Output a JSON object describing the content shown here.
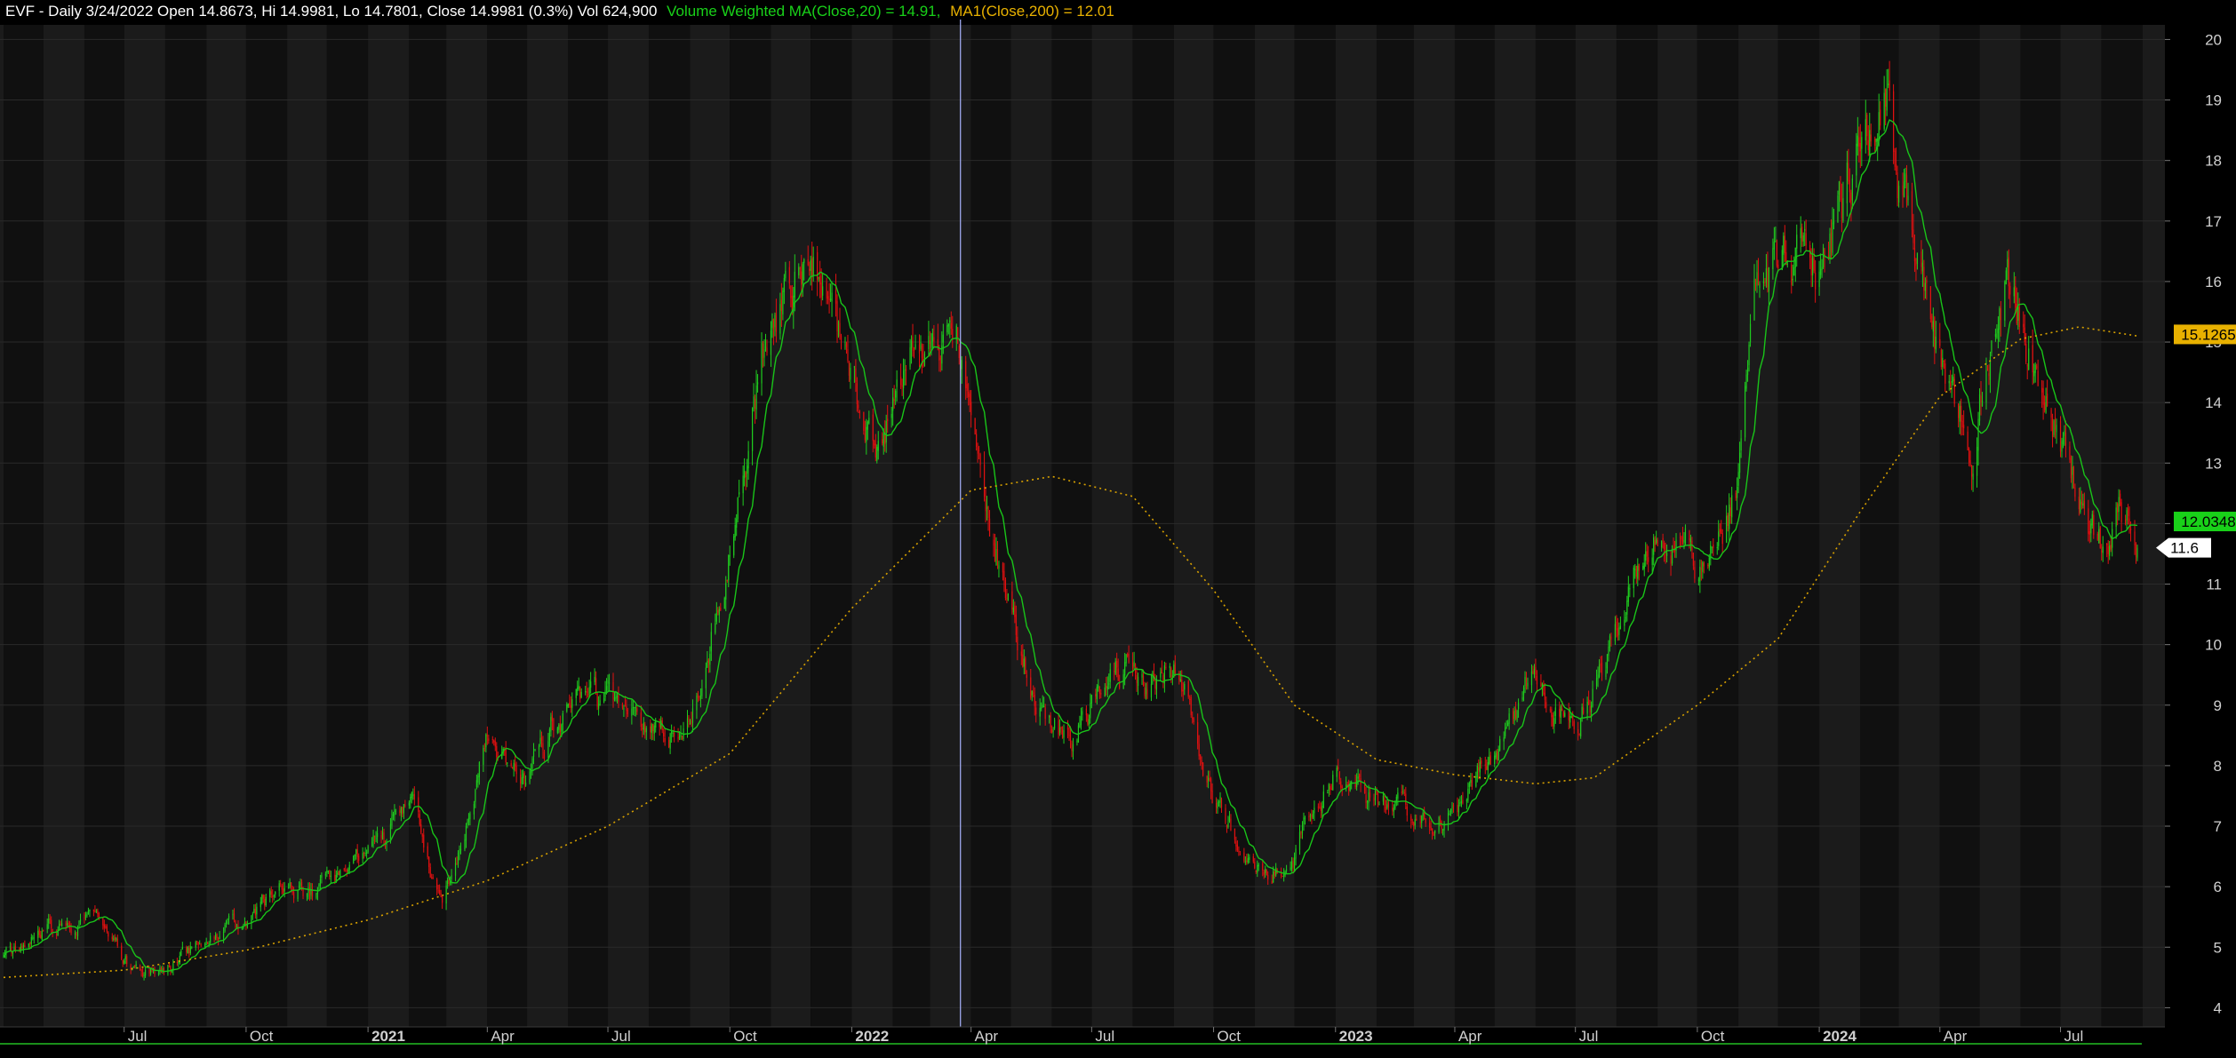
{
  "header": {
    "prefix": "EVF - Daily 3/24/2022 Open 14.8673, Hi 14.9981, Lo 14.7801, Close 14.9981 (0.3%) Vol 624,900",
    "vwma_label": "Volume Weighted MA(Close,20) = 14.91,",
    "ma_label": "MA1(Close,200) = 12.01",
    "colors": {
      "prefix": "#ffffff",
      "vwma": "#19d119",
      "ma": "#e8b100"
    }
  },
  "colors": {
    "background": "#000000",
    "band_light": "#1b1b1b",
    "band_dark": "#101010",
    "grid": "#2a2a2a",
    "up": "#1fcc1f",
    "down": "#e01010",
    "vwma": "#19c419",
    "ma": "#d9a200",
    "crosshair": "#a9b4ff"
  },
  "chart_data": {
    "type": "candlestick",
    "ticker": "EVF",
    "interval": "Daily",
    "ylim": [
      3.8,
      20.3
    ],
    "y_ticks": [
      4,
      5,
      6,
      7,
      8,
      9,
      10,
      11,
      12,
      13,
      14,
      15,
      16,
      17,
      18,
      19,
      20
    ],
    "x_labels": [
      "Jul",
      "Oct",
      "2021",
      "Apr",
      "Jul",
      "Oct",
      "2022",
      "Apr",
      "Jul",
      "Oct",
      "2023",
      "Apr",
      "Jul",
      "Oct",
      "2024",
      "Apr",
      "Jul"
    ],
    "x_label_dates": [
      "2020-07-01",
      "2020-10-01",
      "2021-01-01",
      "2021-04-01",
      "2021-07-01",
      "2021-10-01",
      "2022-01-01",
      "2022-04-01",
      "2022-07-01",
      "2022-10-01",
      "2023-01-01",
      "2023-04-01",
      "2023-07-01",
      "2023-10-01",
      "2024-01-01",
      "2024-04-01",
      "2024-07-01"
    ],
    "x_range": [
      "2020-04-01",
      "2024-08-28"
    ],
    "close_path": [
      [
        "2020-04-01",
        4.8
      ],
      [
        "2020-05-01",
        5.15
      ],
      [
        "2020-06-01",
        5.55
      ],
      [
        "2020-07-01",
        4.7
      ],
      [
        "2020-08-01",
        4.6
      ],
      [
        "2020-09-01",
        5.15
      ],
      [
        "2020-10-01",
        5.55
      ],
      [
        "2020-11-01",
        5.95
      ],
      [
        "2020-12-01",
        5.85
      ],
      [
        "2021-01-01",
        6.4
      ],
      [
        "2021-02-01",
        7.5
      ],
      [
        "2021-02-25",
        5.6
      ],
      [
        "2021-03-15",
        6.9
      ],
      [
        "2021-04-01",
        8.3
      ],
      [
        "2021-05-01",
        7.65
      ],
      [
        "2021-06-01",
        9.1
      ],
      [
        "2021-07-01",
        8.85
      ],
      [
        "2021-08-01",
        8.6
      ],
      [
        "2021-09-01",
        9.05
      ],
      [
        "2021-10-01",
        11.8
      ],
      [
        "2021-11-01",
        15.5
      ],
      [
        "2021-12-01",
        16.3
      ],
      [
        "2022-01-01",
        14.6
      ],
      [
        "2022-01-20",
        12.9
      ],
      [
        "2022-02-10",
        14.5
      ],
      [
        "2022-03-01",
        15.05
      ],
      [
        "2022-03-24",
        14.998
      ],
      [
        "2022-04-15",
        12.0
      ],
      [
        "2022-05-15",
        9.4
      ],
      [
        "2022-06-15",
        8.3
      ],
      [
        "2022-07-15",
        9.65
      ],
      [
        "2022-08-15",
        9.45
      ],
      [
        "2022-09-01",
        9.75
      ],
      [
        "2022-10-01",
        7.4
      ],
      [
        "2022-11-01",
        6.2
      ],
      [
        "2022-12-01",
        6.55
      ],
      [
        "2023-01-01",
        7.95
      ],
      [
        "2023-02-01",
        7.55
      ],
      [
        "2023-03-01",
        7.1
      ],
      [
        "2023-04-01",
        7.35
      ],
      [
        "2023-05-01",
        8.1
      ],
      [
        "2023-06-01",
        9.35
      ],
      [
        "2023-07-01",
        8.5
      ],
      [
        "2023-08-01",
        10.1
      ],
      [
        "2023-09-01",
        12.0
      ],
      [
        "2023-10-01",
        11.3
      ],
      [
        "2023-10-31",
        12.6
      ],
      [
        "2023-11-15",
        16.5
      ],
      [
        "2023-12-01",
        16.3
      ],
      [
        "2024-01-01",
        15.9
      ],
      [
        "2024-02-01",
        18.5
      ],
      [
        "2024-02-20",
        19.4
      ],
      [
        "2024-03-01",
        17.5
      ],
      [
        "2024-04-01",
        14.5
      ],
      [
        "2024-04-25",
        13.2
      ],
      [
        "2024-05-20",
        16.2
      ],
      [
        "2024-06-15",
        14.4
      ],
      [
        "2024-07-10",
        12.9
      ],
      [
        "2024-08-01",
        11.45
      ],
      [
        "2024-08-15",
        12.3
      ],
      [
        "2024-08-28",
        11.6
      ]
    ],
    "series": [
      {
        "name": "Volume Weighted MA(Close,20)",
        "lag_days": 14
      },
      {
        "name": "MA1(Close,200)",
        "points": [
          [
            "2020-04-01",
            4.5
          ],
          [
            "2020-07-01",
            4.62
          ],
          [
            "2020-10-01",
            4.95
          ],
          [
            "2021-01-01",
            5.45
          ],
          [
            "2021-04-01",
            6.1
          ],
          [
            "2021-07-01",
            7.0
          ],
          [
            "2021-10-01",
            8.2
          ],
          [
            "2022-01-01",
            10.6
          ],
          [
            "2022-04-01",
            12.55
          ],
          [
            "2022-06-01",
            12.78
          ],
          [
            "2022-08-01",
            12.45
          ],
          [
            "2022-10-01",
            10.9
          ],
          [
            "2022-12-01",
            9.0
          ],
          [
            "2023-02-01",
            8.1
          ],
          [
            "2023-04-01",
            7.85
          ],
          [
            "2023-06-01",
            7.7
          ],
          [
            "2023-07-15",
            7.8
          ],
          [
            "2023-10-01",
            9.0
          ],
          [
            "2023-12-01",
            10.1
          ],
          [
            "2024-02-01",
            12.2
          ],
          [
            "2024-04-01",
            14.1
          ],
          [
            "2024-06-01",
            15.05
          ],
          [
            "2024-07-15",
            15.25
          ],
          [
            "2024-08-28",
            15.1
          ]
        ]
      }
    ],
    "crosshair_date": "2022-03-24",
    "tags": {
      "ma200": "15.1265",
      "vwma": "12.0348",
      "last": "11.6"
    }
  }
}
